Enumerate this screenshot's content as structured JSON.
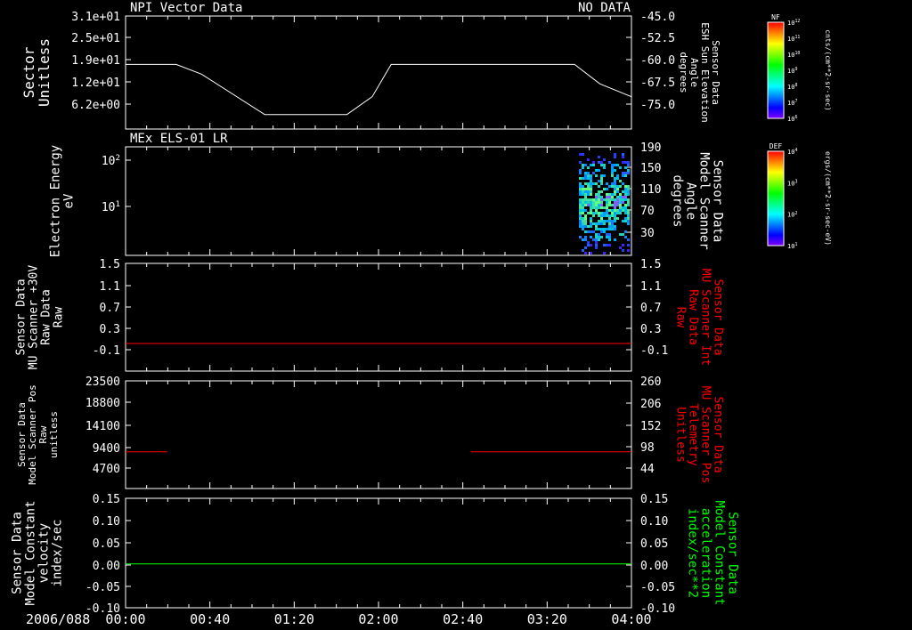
{
  "date_label": "2006/088",
  "time_ticks": [
    "00:00",
    "00:40",
    "01:20",
    "02:00",
    "02:40",
    "03:20",
    "04:00"
  ],
  "chart_data": [
    {
      "type": "line",
      "title": "NPI Vector Data",
      "status": "NO DATA",
      "ylabel_left": [
        "Sector",
        "Unitless"
      ],
      "ylabel_right": [
        "Sensor Data",
        "ESH Sun Elevation",
        "Angle",
        "degrees"
      ],
      "left_ticks": [
        "3.1e+01",
        "2.5e+01",
        "1.9e+01",
        "1.2e+01",
        "6.2e+00"
      ],
      "right_ticks": [
        "-45.0",
        "-52.5",
        "-60.0",
        "-67.5",
        "-75.0"
      ],
      "ylim_right": [
        -80,
        -45
      ],
      "series": [
        {
          "color": "#ffffff",
          "x": [
            0,
            0.4,
            0.6,
            1.1,
            1.4,
            1.52,
            1.75,
            1.95,
            2.1,
            3.25,
            3.4,
            3.55,
            3.75,
            4.0
          ],
          "values": [
            -60,
            -60,
            -63,
            -75.5,
            -75.5,
            -75.5,
            -75.5,
            -70,
            -60,
            -60,
            -60,
            -60,
            -66,
            -70
          ]
        }
      ],
      "colorbar": {
        "label": "NF",
        "units": "cnts/(cm**2-sr-sec)",
        "ticks": [
          "10^12",
          "10^11",
          "10^10",
          "10^9",
          "10^8",
          "10^7",
          "10^6"
        ]
      }
    },
    {
      "type": "heatmap",
      "title": "MEx ELS-01 LR",
      "ylabel_left": [
        "Electron Energy",
        "eV"
      ],
      "ylabel_right": [
        "Sensor Data",
        "Model Scanner",
        "Angle",
        "degrees"
      ],
      "left_ticks": [
        "10^2",
        "10^1"
      ],
      "right_ticks": [
        "190",
        "150",
        "110",
        "70",
        "30"
      ],
      "data_time_range": [
        "03:38",
        "04:00"
      ],
      "colorbar": {
        "label": "DEF",
        "units": "ergs/(cm**2-sr-sec-eV)",
        "ticks": [
          "10^4",
          "10^3",
          "10^2",
          "10^1"
        ]
      }
    },
    {
      "type": "line",
      "ylabel_left": [
        "Sensor Data",
        "MU Scanner +30V",
        "Raw Data",
        "Raw"
      ],
      "ylabel_right": [
        "Sensor Data",
        "MU Scanner Int",
        "Raw Data",
        "Raw"
      ],
      "left_ticks": [
        "1.5",
        "1.1",
        "0.7",
        "0.3",
        "-0.1"
      ],
      "right_ticks": [
        "1.5",
        "1.1",
        "0.7",
        "0.3",
        "-0.1"
      ],
      "ylim": [
        -0.3,
        1.5
      ],
      "series": [
        {
          "color": "#ff0000",
          "x": [
            0,
            4
          ],
          "values": [
            -0.05,
            -0.05
          ]
        }
      ]
    },
    {
      "type": "line",
      "ylabel_left": [
        "Sensor Data",
        "Model Scanner Pos",
        "Raw",
        "unitless"
      ],
      "ylabel_right": [
        "Sensor Data",
        "MU Scanner Pos",
        "Telemetry",
        "Unitless"
      ],
      "left_ticks": [
        "23500",
        "18800",
        "14100",
        "9400",
        "4700"
      ],
      "right_ticks": [
        "260",
        "206",
        "152",
        "98",
        "44"
      ],
      "ylim_left": [
        0,
        23500
      ],
      "series": [
        {
          "color": "#ff0000",
          "segments": [
            [
              [
                0,
                8000
              ],
              [
                0.33,
                8000
              ]
            ],
            [
              [
                2.73,
                8000
              ],
              [
                4.0,
                8000
              ]
            ]
          ]
        }
      ]
    },
    {
      "type": "line",
      "ylabel_left": [
        "Sensor Data",
        "Model Constant",
        "velocity",
        "index/sec"
      ],
      "ylabel_right": [
        "Sensor Data",
        "Model Constant",
        "acceleration",
        "index/sec**2"
      ],
      "left_ticks": [
        "0.15",
        "0.10",
        "0.05",
        "0.00",
        "-0.05",
        "-0.10"
      ],
      "right_ticks": [
        "0.15",
        "0.10",
        "0.05",
        "0.00",
        "-0.05",
        "-0.10"
      ],
      "ylim": [
        -0.1,
        0.15
      ],
      "series": [
        {
          "color": "#00ff00",
          "x": [
            0,
            4
          ],
          "values": [
            0,
            0
          ]
        }
      ]
    }
  ]
}
